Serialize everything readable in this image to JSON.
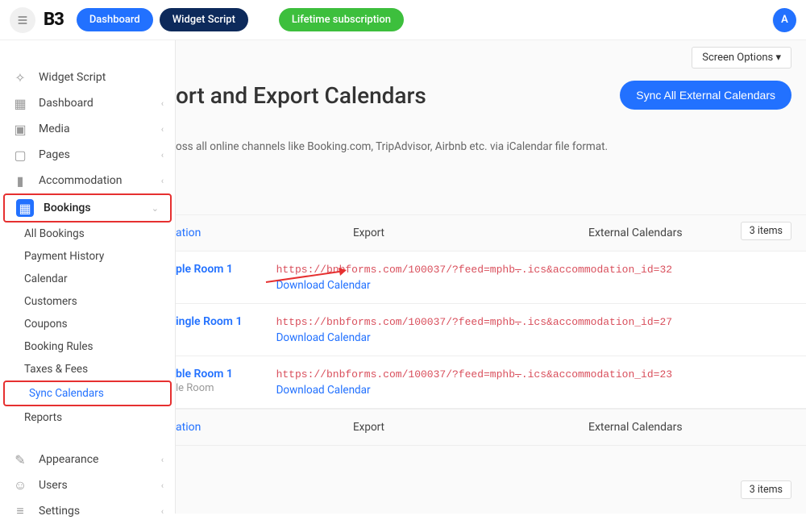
{
  "topbar": {
    "logo": "B3",
    "dashboard": "Dashboard",
    "widget_script": "Widget Script",
    "lifetime": "Lifetime subscription",
    "avatar": "A"
  },
  "sidebar": {
    "items": [
      {
        "label": "Widget Script",
        "icon": "code"
      },
      {
        "label": "Dashboard",
        "icon": "grid",
        "chevron": true
      },
      {
        "label": "Media",
        "icon": "image",
        "chevron": true
      },
      {
        "label": "Pages",
        "icon": "page",
        "chevron": true
      },
      {
        "label": "Accommodation",
        "icon": "building",
        "chevron": true
      },
      {
        "label": "Bookings",
        "icon": "calendar",
        "chevron": true,
        "active": true
      }
    ],
    "sub": [
      {
        "label": "All Bookings"
      },
      {
        "label": "Payment History"
      },
      {
        "label": "Calendar"
      },
      {
        "label": "Customers"
      },
      {
        "label": "Coupons"
      },
      {
        "label": "Booking Rules"
      },
      {
        "label": "Taxes & Fees"
      },
      {
        "label": "Sync Calendars",
        "current": true
      },
      {
        "label": "Reports"
      }
    ],
    "bottom": [
      {
        "label": "Appearance",
        "icon": "brush",
        "chevron": true
      },
      {
        "label": "Users",
        "icon": "user",
        "chevron": true
      },
      {
        "label": "Settings",
        "icon": "sliders",
        "chevron": true
      }
    ]
  },
  "main": {
    "screen_options": "Screen Options ▾",
    "title": "ort and Export Calendars",
    "sync_btn": "Sync All External Calendars",
    "desc": "oss all online channels like Booking.com, TripAdvisor, Airbnb etc. via iCalendar file format.",
    "items_count": "3 items",
    "headers": {
      "acc": "ation",
      "exp": "Export",
      "ext": "External Calendars"
    },
    "rows": [
      {
        "acc_link": "ple Room 1",
        "acc_sub": "",
        "url_a": "https://bnbforms.com/100037/?feed=mphb",
        "url_b": ".ics&accommodation_id=32",
        "download": "Download Calendar"
      },
      {
        "acc_link": "ingle Room 1",
        "acc_sub": "",
        "url_a": "https://bnbforms.com/100037/?feed=mphb",
        "url_b": ".ics&accommodation_id=27",
        "download": "Download Calendar"
      },
      {
        "acc_link": "ble Room 1",
        "acc_sub": "le Room",
        "url_a": "https://bnbforms.com/100037/?feed=mphb",
        "url_b": ".ics&accommodation_id=23",
        "download": "Download Calendar"
      }
    ]
  }
}
